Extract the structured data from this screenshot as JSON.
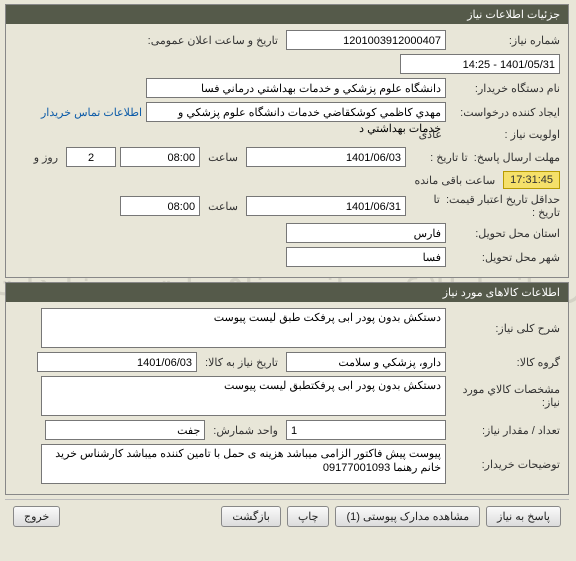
{
  "watermark": "رسانه اطلاع رسانی مناقصات و مزایدات",
  "panel1": {
    "title": "جزئیات اطلاعات نیاز",
    "need_no_label": "شماره نیاز:",
    "need_no": "1201003912000407",
    "announce_label": "تاریخ و ساعت اعلان عمومی:",
    "announce_value": "1401/05/31 - 14:25",
    "buyer_name_label": "نام دستگاه خریدار:",
    "buyer_name": "دانشگاه علوم پزشکي و خدمات بهداشتي درماني فسا",
    "creator_label": "ایجاد کننده درخواست:",
    "creator": "مهدي  كاظمي كوشكقاضي خدمات دانشگاه علوم پزشکي و خدمات بهداشتي د",
    "contact_link": "اطلاعات تماس خریدار",
    "priority_label": "اولویت نیاز :",
    "priority": "عادی",
    "deadline_label": "مهلت ارسال پاسخ:",
    "until_label": "تا تاریخ :",
    "date1": "1401/06/03",
    "time_label": "ساعت",
    "time1": "08:00",
    "days_val": "2",
    "days_label": "روز و",
    "countdown": "17:31:45",
    "remain_label": "ساعت باقی مانده",
    "validity_label": "حداقل تاریخ اعتبار قیمت:",
    "date2": "1401/06/31",
    "time2": "08:00",
    "province_label": "استان محل تحویل:",
    "province": "فارس",
    "city_label": "شهر محل تحویل:",
    "city": "فسا"
  },
  "panel2": {
    "title": "اطلاعات کالاهای مورد نیاز",
    "desc_label": "شرح کلی نیاز:",
    "desc": "دستکش بدون پودر ابی پرفکت طبق لیست پیوست",
    "group_label": "گروه کالا:",
    "group": "دارو، پزشكي و سلامت",
    "need_date_label": "تاریخ نیاز به کالا:",
    "need_date": "1401/06/03",
    "spec_label": "مشخصات کالاي مورد نیاز:",
    "spec": "دستکش بدون پودر ابی پرفکتطبق لیست پیوست",
    "qty_label": "تعداد / مقدار نیاز:",
    "qty": "1",
    "unit_label": "واحد شمارش:",
    "unit": "جفت",
    "notes_label": "توضیحات خریدار:",
    "notes": "پیوست پیش فاکتور الزامی میباشد هزینه ی حمل با تامین کننده میباشد کارشناس خرید خانم رهنما 09177001093"
  },
  "buttons": {
    "reply": "پاسخ به نیاز",
    "attachments": "مشاهده مدارک پیوستی (1)",
    "print": "چاپ",
    "back": "بازگشت",
    "exit": "خروج"
  }
}
